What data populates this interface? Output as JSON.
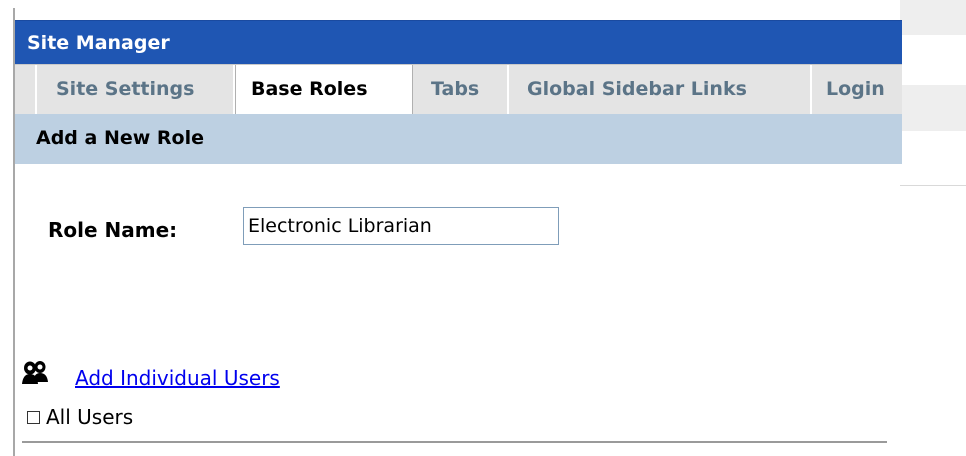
{
  "header": {
    "title": "Site Manager"
  },
  "tabs": [
    {
      "label": "Site Settings",
      "active": false
    },
    {
      "label": "Base Roles",
      "active": true
    },
    {
      "label": "Tabs",
      "active": false
    },
    {
      "label": "Global Sidebar Links",
      "active": false
    },
    {
      "label": "Login",
      "active": false
    }
  ],
  "section": {
    "title": "Add a New Role"
  },
  "form": {
    "role_name_label": "Role Name:",
    "role_name_value": "Electronic Librarian"
  },
  "users": {
    "icon": "users-icon",
    "add_link_label": "Add Individual Users",
    "all_users_label": "All Users",
    "all_users_checked": false
  },
  "colors": {
    "title_bar": "#1f56b3",
    "tab_bar": "#e4e4e4",
    "inactive_tab_text": "#5b7487",
    "section_header": "#bdd0e2",
    "link": "#0000ee"
  }
}
